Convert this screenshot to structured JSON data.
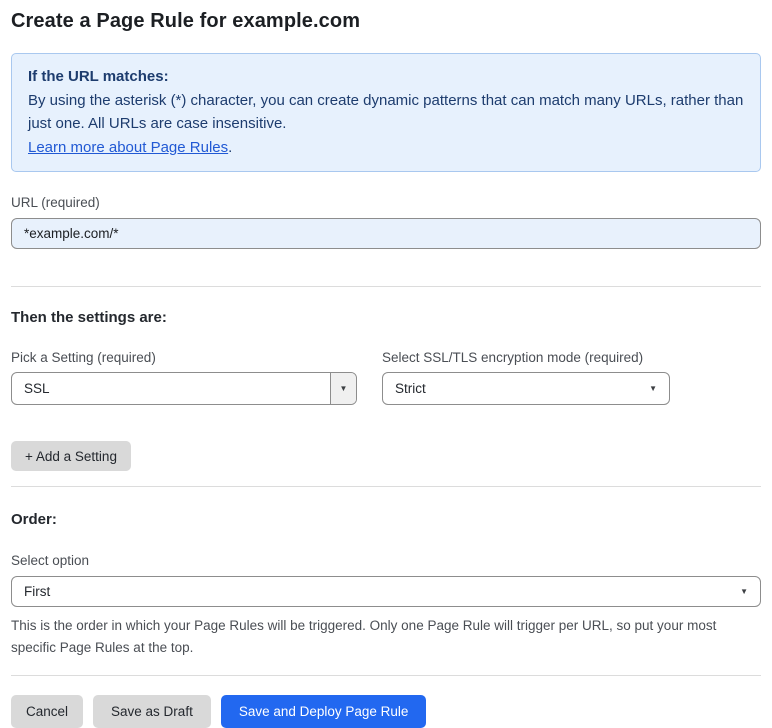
{
  "page": {
    "title": "Create a Page Rule for example.com"
  },
  "notice": {
    "heading": "If the URL matches:",
    "body": "By using the asterisk (*) character, you can create dynamic patterns that can match many URLs, rather than just one. All URLs are case insensitive.",
    "link_label": "Learn more about Page Rules",
    "link_suffix": ".",
    "background": "#e7f1fd",
    "border_color": "#a9c8ef",
    "text_color": "#1d3c6e",
    "link_color": "#2159d4"
  },
  "url_field": {
    "label": "URL (required)",
    "value": "*example.com/*",
    "background": "#e8f1fc"
  },
  "settings_section": {
    "heading": "Then the settings are:",
    "setting_picker": {
      "label": "Pick a Setting (required)",
      "selected": "SSL"
    },
    "ssl_mode_picker": {
      "label": "Select SSL/TLS encryption mode (required)",
      "selected": "Strict"
    },
    "add_setting_label": "+ Add a Setting"
  },
  "order_section": {
    "heading": "Order:",
    "select_label": "Select option",
    "selected": "First",
    "help_text": "This is the order in which your Page Rules will be triggered. Only one Page Rule will trigger per URL, so put your most specific Page Rules at the top."
  },
  "footer": {
    "cancel_label": "Cancel",
    "save_draft_label": "Save as Draft",
    "save_deploy_label": "Save and Deploy Page Rule",
    "primary_color": "#2268f0"
  },
  "icons": {
    "dropdown_arrow": "▼"
  }
}
